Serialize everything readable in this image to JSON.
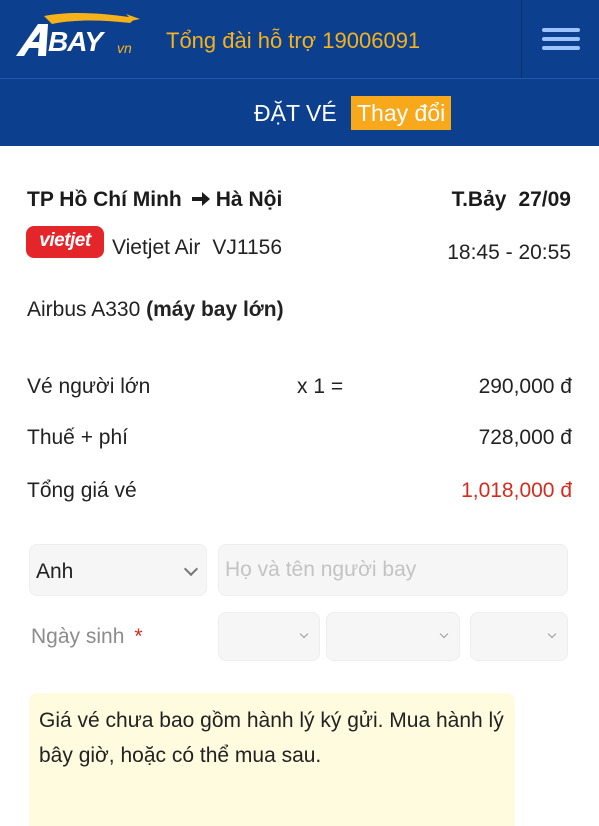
{
  "header": {
    "logo_text": "BAY",
    "logo_suffix": "vn",
    "hotline_text": "Tổng đài hỗ trợ 19006091",
    "menu_icon": "hamburger-menu-icon"
  },
  "subheader": {
    "title": "ĐẶT VÉ",
    "change_label": "Thay đổi"
  },
  "flight": {
    "from": "TP Hồ Chí Minh",
    "to": "Hà Nội",
    "arrow_icon": "arrow-right-icon",
    "day_of_week": "T.Bảy",
    "date": "27/09",
    "airline_logo_text": "vietjet",
    "airline": "Vietjet Air",
    "flight_no": "VJ1156",
    "time_range": "18:45 - 20:55",
    "aircraft": "Airbus A330",
    "aircraft_note": "(máy bay lớn)"
  },
  "pricing": {
    "adult_label": "Vé người lớn",
    "adult_qty": "x 1 =",
    "adult_price": "290,000 đ",
    "tax_label": "Thuế + phí",
    "tax_price": "728,000 đ",
    "total_label": "Tổng giá vé",
    "total_price": "1,018,000 đ"
  },
  "form": {
    "title_value": "Anh",
    "name_placeholder": "Họ và tên người bay",
    "dob_label": "Ngày sinh",
    "required_mark": "*"
  },
  "notice": {
    "text": "Giá vé chưa bao gồm hành lý ký gửi. Mua hành lý bây giờ, hoặc có thể mua sau."
  },
  "colors": {
    "header_bg": "#0d3f8f",
    "accent_orange": "#f7a81b",
    "total_red": "#d52b1e",
    "notice_bg": "#fffbdf"
  }
}
